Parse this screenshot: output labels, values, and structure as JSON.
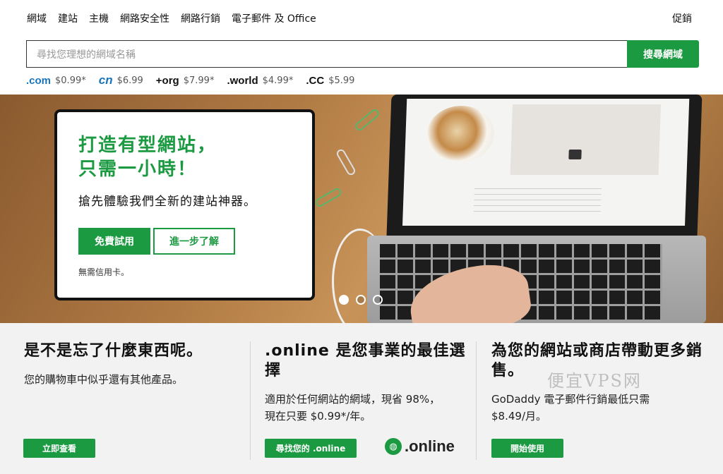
{
  "nav": {
    "items": [
      "網域",
      "建站",
      "主機",
      "網路安全性",
      "網路行銷",
      "電子郵件 及 Office"
    ],
    "promo": "促銷"
  },
  "search": {
    "placeholder": "尋找您理想的網域名稱",
    "button": "搜尋網域"
  },
  "tlds": [
    {
      "name": ".com",
      "price": "$0.99*"
    },
    {
      "name": "cn",
      "price": "$6.99"
    },
    {
      "name": "+org",
      "price": "$7.99*"
    },
    {
      "name": ".world",
      "price": "$4.99*"
    },
    {
      "name": ".CC",
      "price": "$5.99"
    }
  ],
  "hero": {
    "title": "打造有型網站，\n只需一小時！",
    "subtitle": "搶先體驗我們全新的建站神器。",
    "primary_button": "免費試用",
    "secondary_button": "進一步了解",
    "note": "無需信用卡。"
  },
  "carousel": {
    "count": 3,
    "active": 0
  },
  "cards": [
    {
      "title": "是不是忘了什麼東西呢。",
      "text": "您的購物車中似乎還有其他產品。",
      "button": "立即查看"
    },
    {
      "title": ".online 是您事業的最佳選擇",
      "text": "適用於任何網站的網域，現省 98%，現在只要 $0.99*/年。",
      "button": "尋找您的 .online"
    },
    {
      "title": "為您的網站或商店帶動更多銷售。",
      "text": "GoDaddy 電子郵件行銷最低只需 $8.49/月。",
      "button": "開始使用"
    }
  ],
  "online_logo": ".online",
  "watermark": "便宜VPS网",
  "colors": {
    "accent": "#1c9a42"
  }
}
